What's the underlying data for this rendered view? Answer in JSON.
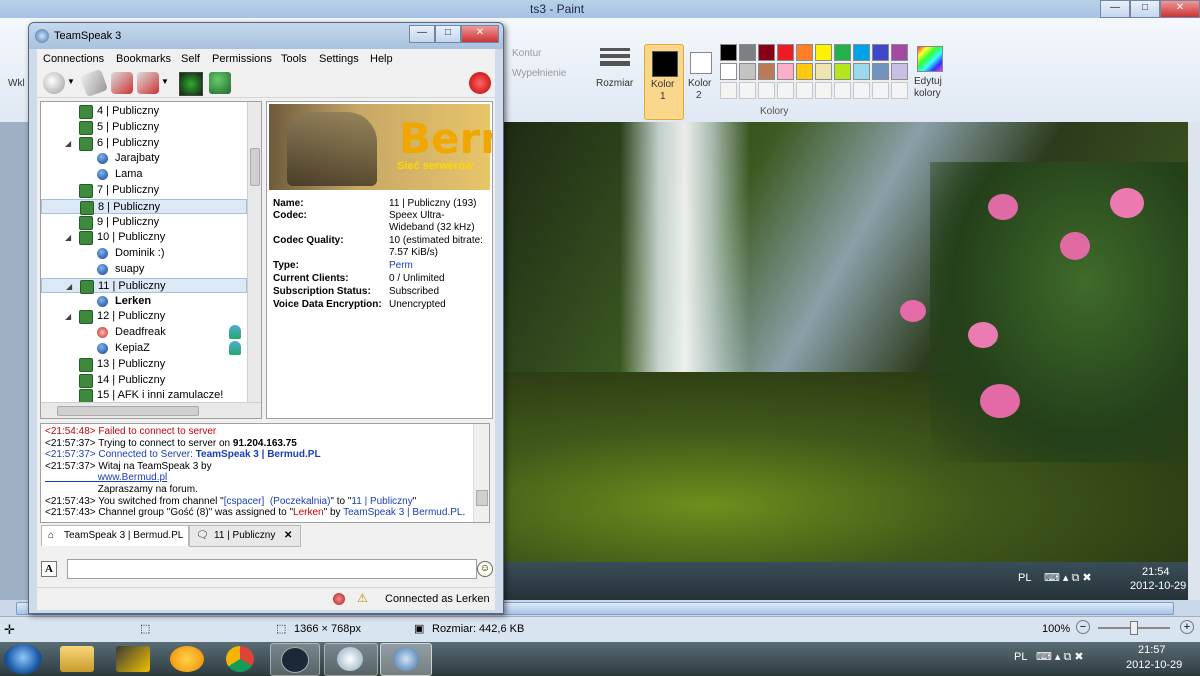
{
  "paint": {
    "title": "ts3 - Paint",
    "ribbon": {
      "kontur": "Kontur",
      "wypelnienie": "Wypełnienie",
      "rozmiar": "Rozmiar",
      "kolor1": "Kolor\n1",
      "kolor1_line1": "Kolor",
      "kolor1_line2": "1",
      "kolor2_line1": "Kolor",
      "kolor2_line2": "2",
      "edit_colors_line1": "Edytuj",
      "edit_colors_line2": "kolory",
      "group_label": "Kolory",
      "left_label": "Wkl"
    },
    "palette_colors": [
      "#000000",
      "#7f7f7f",
      "#880015",
      "#ed1c24",
      "#ff7f27",
      "#fff200",
      "#22b14c",
      "#00a2e8",
      "#3f48cc",
      "#a349a4",
      "#ffffff",
      "#c3c3c3",
      "#b97a57",
      "#ffaec9",
      "#ffc90e",
      "#efe4b0",
      "#b5e61d",
      "#99d9ea",
      "#7092be",
      "#c8bfe7"
    ],
    "status": {
      "dimensions": "1366 × 768px",
      "size": "Rozmiar: 442,6 KB",
      "zoom": "100%"
    },
    "inner_tray": {
      "lang": "PL",
      "time": "21:54",
      "date": "2012-10-29"
    }
  },
  "taskbar": {
    "lang": "PL",
    "time": "21:57",
    "date": "2012-10-29"
  },
  "ts": {
    "title": "TeamSpeak 3",
    "menu": [
      "Connections",
      "Bookmarks",
      "Self",
      "Permissions",
      "Tools",
      "Settings",
      "Help"
    ],
    "tree": [
      {
        "type": "channel",
        "label": "4 | Publiczny",
        "indent": 1,
        "expand": ""
      },
      {
        "type": "channel",
        "label": "5 | Publiczny",
        "indent": 1,
        "expand": ""
      },
      {
        "type": "channel",
        "label": "6 | Publiczny",
        "indent": 1,
        "expand": "◢"
      },
      {
        "type": "client",
        "label": "Jarajbaty",
        "indent": 2
      },
      {
        "type": "client",
        "label": "Lama",
        "indent": 2
      },
      {
        "type": "channel",
        "label": "7 | Publiczny",
        "indent": 1,
        "expand": ""
      },
      {
        "type": "channel",
        "label": "8 | Publiczny",
        "indent": 1,
        "expand": "",
        "selected": true
      },
      {
        "type": "channel",
        "label": "9 | Publiczny",
        "indent": 1,
        "expand": ""
      },
      {
        "type": "channel",
        "label": "10 | Publiczny",
        "indent": 1,
        "expand": "◢"
      },
      {
        "type": "client",
        "label": "Dominik :)",
        "indent": 2
      },
      {
        "type": "client",
        "label": "suapy",
        "indent": 2
      },
      {
        "type": "channel",
        "label": "11 | Publiczny",
        "indent": 1,
        "expand": "◢",
        "selected": true
      },
      {
        "type": "client",
        "label": "Lerken",
        "indent": 2,
        "bold": true
      },
      {
        "type": "channel",
        "label": "12 | Publiczny",
        "indent": 1,
        "expand": "◢"
      },
      {
        "type": "client",
        "label": "Deadfreak",
        "indent": 2,
        "away": true,
        "badge": true
      },
      {
        "type": "client",
        "label": "KepiaZ",
        "indent": 2,
        "badge": true
      },
      {
        "type": "channel",
        "label": "13 | Publiczny",
        "indent": 1,
        "expand": ""
      },
      {
        "type": "channel",
        "label": "14 | Publiczny",
        "indent": 1,
        "expand": ""
      },
      {
        "type": "channel",
        "label": "15 | AFK i inni zamulacze!",
        "indent": 1,
        "expand": ""
      }
    ],
    "banner": {
      "big": "Berm",
      "small": "Sieć serwerów"
    },
    "info": [
      {
        "key": "Name:",
        "value": "11 | Publiczny (193)"
      },
      {
        "key": "Codec:",
        "value": "Speex Ultra-Wideband (32 kHz)"
      },
      {
        "key": "Codec Quality:",
        "value": "10 (estimated bitrate: 7.57 KiB/s)"
      },
      {
        "key": "Type:",
        "value": "Perm"
      },
      {
        "key": "Current Clients:",
        "value": "0 / Unlimited"
      },
      {
        "key": "Subscription Status:",
        "value": "Subscribed"
      },
      {
        "key": "Voice Data Encryption:",
        "value": "Unencrypted"
      }
    ],
    "log": [
      {
        "parts": [
          {
            "t": "<21:54:48> Failed to connect to server",
            "c": "#cc0000"
          }
        ]
      },
      {
        "parts": [
          {
            "t": "<21:57:37> Trying to connect to server on ",
            "c": "#000"
          },
          {
            "t": "91.204.163.75",
            "c": "#000",
            "b": true
          }
        ]
      },
      {
        "parts": [
          {
            "t": "<21:57:37> Connected to Server: ",
            "c": "#1a3fb5"
          },
          {
            "t": "TeamSpeak 3 | Bermud.PL",
            "c": "#1a3fb5",
            "b": true
          }
        ]
      },
      {
        "parts": [
          {
            "t": "<21:57:37> Witaj na TeamSpeak 3 by",
            "c": "#000"
          }
        ]
      },
      {
        "parts": [
          {
            "t": "                   www.Bermud.pl",
            "c": "#1a3fb5",
            "u": true
          }
        ]
      },
      {
        "parts": [
          {
            "t": "                   Zapraszamy na forum.",
            "c": "#000"
          }
        ]
      },
      {
        "parts": [
          {
            "t": "<21:57:43> You switched from channel \"",
            "c": "#000"
          },
          {
            "t": "[cspacer]  (Poczekalnia)",
            "c": "#1a3fb5"
          },
          {
            "t": "\" to \"",
            "c": "#000"
          },
          {
            "t": "11 | Publiczny",
            "c": "#1a3fb5"
          },
          {
            "t": "\"",
            "c": "#000"
          }
        ]
      },
      {
        "parts": [
          {
            "t": "<21:57:43> Channel group \"Gość (8)\" was assigned to \"",
            "c": "#000"
          },
          {
            "t": "Lerken",
            "c": "#cc0000"
          },
          {
            "t": "\" by ",
            "c": "#000"
          },
          {
            "t": "TeamSpeak 3 | Bermud.PL",
            "c": "#1a3fb5"
          },
          {
            "t": ".",
            "c": "#000"
          }
        ]
      }
    ],
    "tabs": [
      {
        "label": "TeamSpeak 3 | Bermud.PL"
      },
      {
        "label": "11 | Publiczny",
        "close": "✕"
      }
    ],
    "status": "Connected as Lerken"
  }
}
